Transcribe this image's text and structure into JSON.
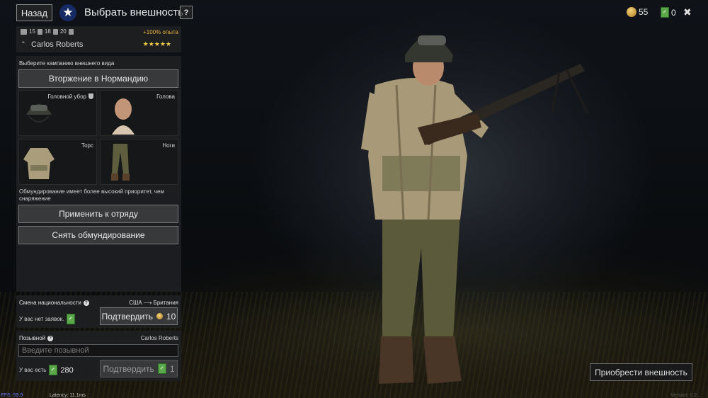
{
  "header": {
    "back_label": "Назад",
    "title": "Выбрать внешность",
    "help_label": "?",
    "gold_amount": "55",
    "tickets_amount": "0",
    "close_icon": "close-icon"
  },
  "soldier": {
    "stat_1": "15",
    "stat_2": "18",
    "stat_3": "20",
    "exp_bonus": "+100% опыта",
    "name": "Carlos Roberts",
    "stars": "★★★★★"
  },
  "appearance": {
    "campaign_label": "Выберите кампанию внешнего вида",
    "campaign_value": "Вторжение в Нормандию",
    "slots": {
      "headgear": "Головной убор",
      "head": "Голова",
      "torso": "Торс",
      "legs": "Ноги"
    },
    "note": "Обмундирование имеет более высокий приоритет, чем снаряжение",
    "apply_label": "Применить к отряду",
    "remove_label": "Снять обмундирование"
  },
  "nationality": {
    "title": "Смена национальности",
    "from": "США",
    "to": "Британия",
    "no_requests": "У вас нет заявок.",
    "confirm_label": "Подтвердить",
    "confirm_cost": "10"
  },
  "callsign": {
    "title": "Позывной",
    "current": "Carlos Roberts",
    "placeholder": "Введите позывной",
    "have_label": "У вас есть",
    "have_amount": "280",
    "confirm_label": "Подтвердить",
    "confirm_cost": "1"
  },
  "buy_label": "Приобрести внешность",
  "debug": {
    "fps": "FPS: 59.9",
    "latency": "Latency: 11.1ms",
    "version": "Version: 0.2..."
  },
  "colors": {
    "accent_gold": "#e8b040",
    "star_yellow": "#f2c94c",
    "ticket_green": "#5aa84a",
    "badge_blue": "#162a63"
  }
}
